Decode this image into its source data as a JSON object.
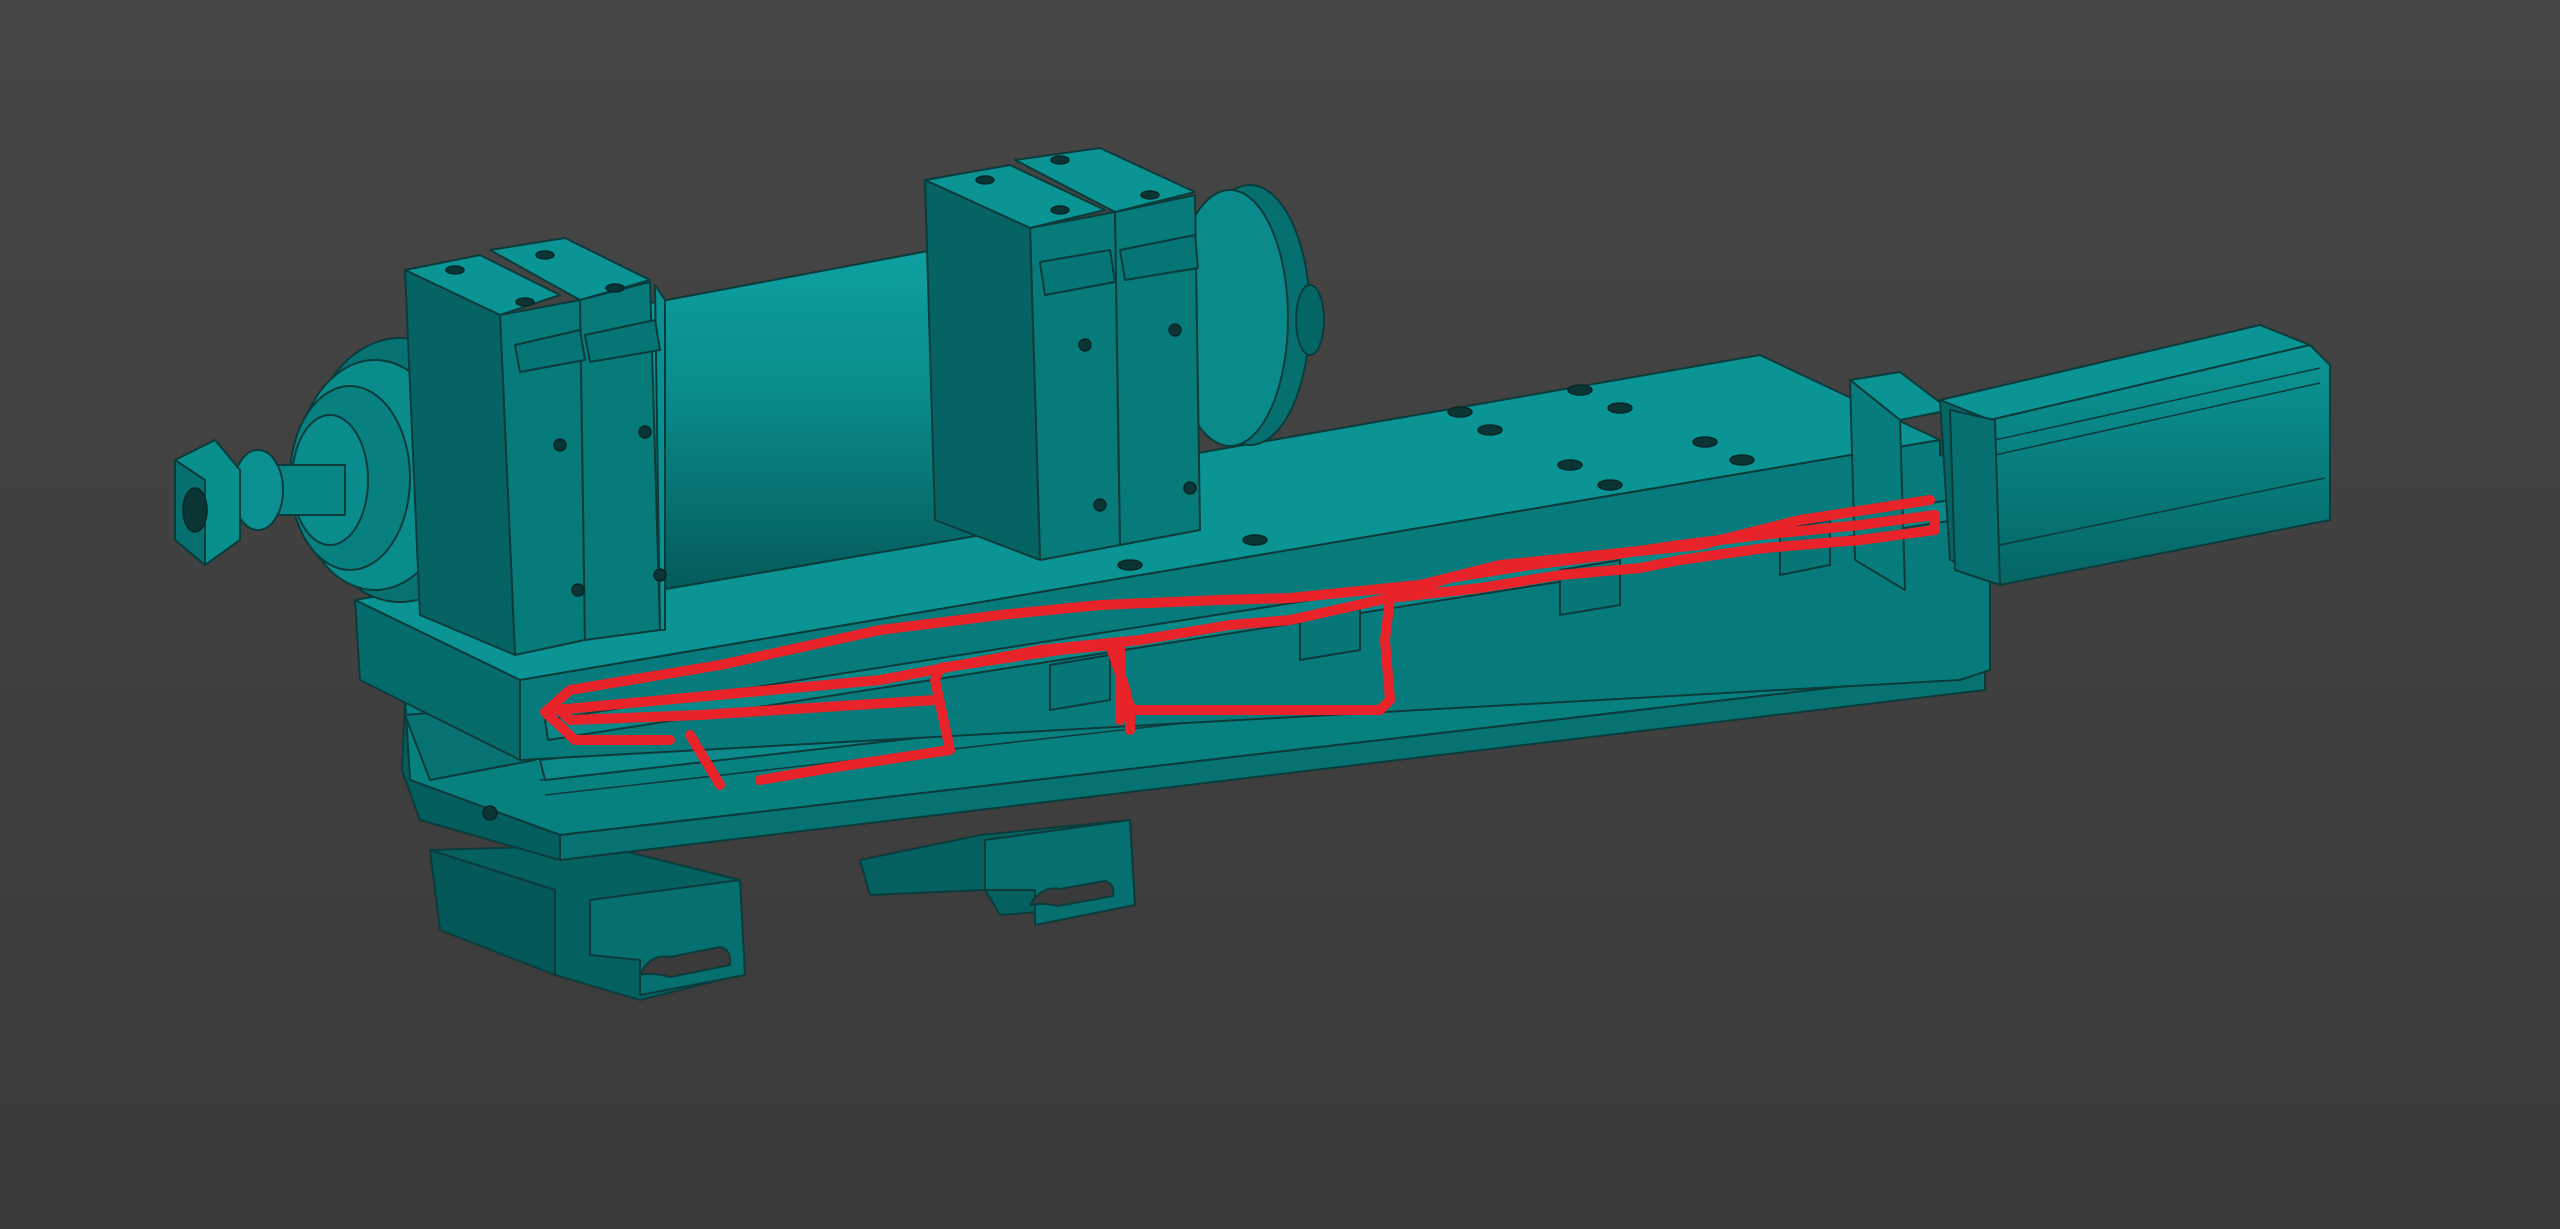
{
  "colors": {
    "background": "#3a3a3a",
    "background_gradient_top": "#464646",
    "model_face_top": "#0a8f8f",
    "model_face_front": "#067a7a",
    "model_face_side": "#056464",
    "model_edge": "#0c3b3b",
    "annotation": "#e8242a"
  },
  "scene": {
    "components": [
      "spindle-motor",
      "spindle-collet-nut",
      "spindle-clamp-front",
      "spindle-clamp-rear",
      "carriage-plate",
      "base-rail-block",
      "stepper-motor",
      "rail-carriage-front",
      "rail-carriage-rear"
    ]
  },
  "annotation": {
    "kind": "freehand-outline",
    "icon": "freehand-pen-stroke"
  }
}
